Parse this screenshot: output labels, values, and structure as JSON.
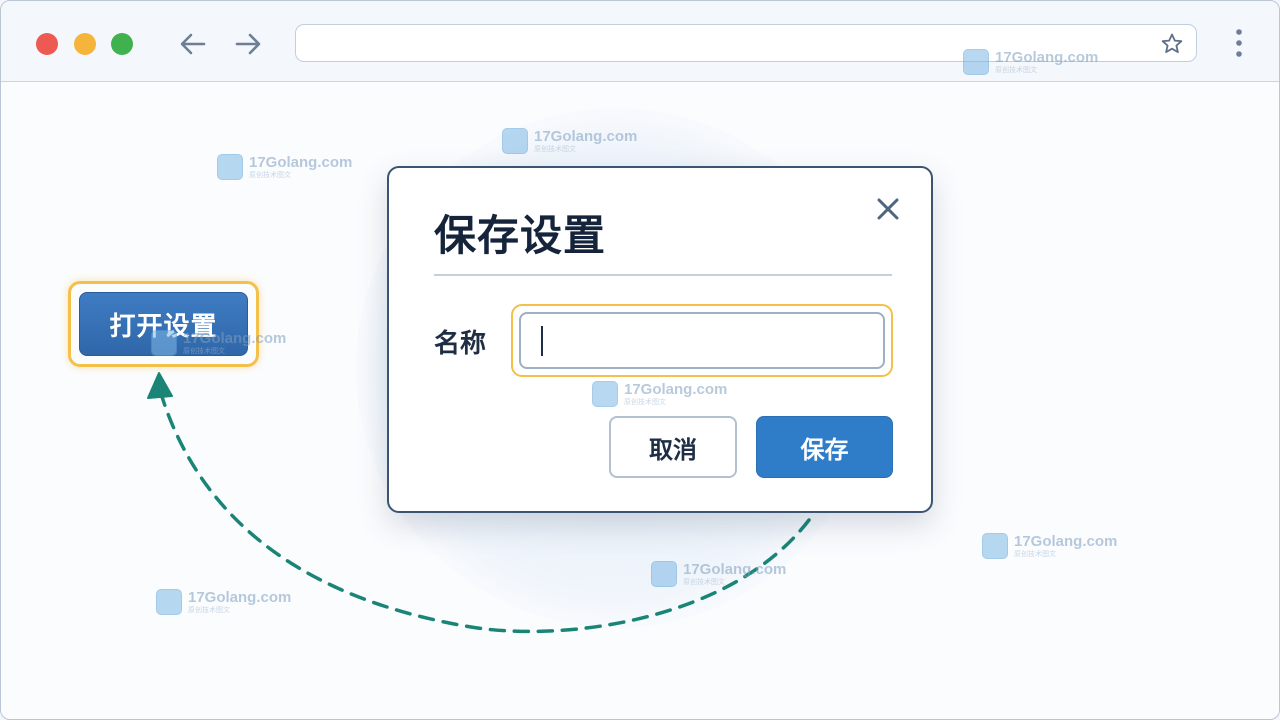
{
  "browser": {
    "address_value": "",
    "controls": [
      "close-dot",
      "minimize-dot",
      "maximize-dot"
    ]
  },
  "page": {
    "open_settings_label": "打开设置"
  },
  "dialog": {
    "title": "保存设置",
    "name_label": "名称",
    "name_value": "",
    "cancel_label": "取消",
    "save_label": "保存"
  },
  "watermark": {
    "text": "17Golang.com",
    "subtext": "原创技术图文"
  },
  "colors": {
    "primary_button": "#2f7dc9",
    "open_button": "#3a73b8",
    "focus_ring": "#f5c04a",
    "flow_arrow": "#1a8577",
    "dialog_border": "#3a5472"
  }
}
